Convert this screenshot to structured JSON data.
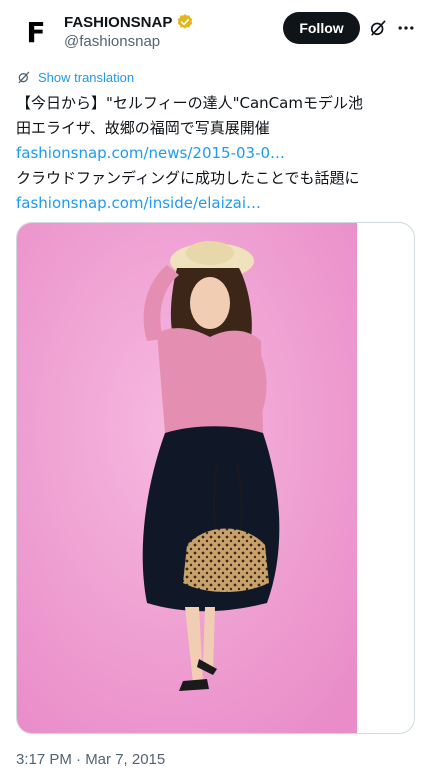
{
  "account": {
    "avatar_letter": "F",
    "display_name": "FASHIONSNAP",
    "handle": "@fashionsnap",
    "verified_badge": "gold-check-badge-icon"
  },
  "actions": {
    "follow_label": "Follow",
    "grok_icon": "grok-icon",
    "more_icon": "more-icon"
  },
  "translation": {
    "icon": "translate-icon",
    "label": "Show translation"
  },
  "tweet": {
    "line1": "【今日から】\"セルフィーの達人\"CanCamモデル池",
    "line2": "田エライザ、故郷の福岡で写真展開催",
    "link1": "fashionsnap.com/news/2015-03-0…",
    "line4": "クラウドファンディングに成功したことでも話題に",
    "link2": "fashionsnap.com/inside/elaizai…"
  },
  "media": {
    "alt": "Photo of model on pink background"
  },
  "meta": {
    "timestamp": "3:17 PM · Mar 7, 2015"
  },
  "colors": {
    "link": "#1d9bf0",
    "secondary_text": "#536471",
    "follow_bg": "#0f1419",
    "photo_background": "#ef9bd0",
    "badge_gold": "#e2b719"
  }
}
